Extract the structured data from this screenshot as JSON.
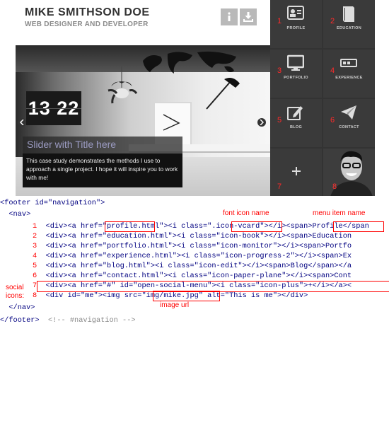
{
  "site": {
    "name": "MIKE SMITHSON DOE",
    "role": "WEB DESIGNER AND DEVELOPER"
  },
  "slider": {
    "clock": "13 22",
    "title": "Slider with Title here",
    "text": "This case study demonstrates the methods I use to approach a single project. I hope it will inspire you to work with me!"
  },
  "nav_tiles": [
    {
      "num": "1",
      "label": "PROFILE",
      "icon": "vcard-icon"
    },
    {
      "num": "2",
      "label": "EDUCATION",
      "icon": "book-icon"
    },
    {
      "num": "3",
      "label": "PORTFOLIO",
      "icon": "monitor-icon"
    },
    {
      "num": "4",
      "label": "EXPERIENCE",
      "icon": "progress-icon"
    },
    {
      "num": "5",
      "label": "BLOG",
      "icon": "edit-icon"
    },
    {
      "num": "6",
      "label": "CONTACT",
      "icon": "paper-plane-icon"
    },
    {
      "num": "7",
      "label": "",
      "icon": "plus-icon"
    },
    {
      "num": "8",
      "label": "",
      "icon": "photo"
    }
  ],
  "code": {
    "line_open_footer": "<footer id=\"navigation\">",
    "line_open_nav": "  <nav>",
    "lines": [
      {
        "num": "1",
        "text": "  <div><a href=\"profile.html\"><i class=\".icon-vcard\"></i><span>Profile</span"
      },
      {
        "num": "2",
        "text": "  <div><a href=\"education.html\"><i class=\"icon-book\"></i><span>Education"
      },
      {
        "num": "3",
        "text": "  <div><a href=\"portfolio.html\"><i class=\"icon-monitor\"></i><span>Portfo"
      },
      {
        "num": "4",
        "text": "  <div><a href=\"experience.html\"><i class=\"icon-progress-2\"></i><span>Ex"
      },
      {
        "num": "5",
        "text": "  <div><a href=\"blog.html\"><i class=\"icon-edit\"></i><span>Blog</span></a"
      },
      {
        "num": "6",
        "text": "  <div><a href=\"contact.html\"><i class=\"icon-paper-plane\"></i><span>Cont"
      },
      {
        "num": "7",
        "text": "  <div><a href=\"#\" id=\"open-social-menu\"><i class=\"icon-plus\">+</i></a><"
      },
      {
        "num": "8",
        "text": "  <div id=\"me\"><img src=\"img/mike.jpg\" alt=\"This is me\"></div>"
      }
    ],
    "line_close_nav": "  </nav>",
    "line_close_footer": "</footer>",
    "comment": "  <!-- #navigation -->"
  },
  "annotations": {
    "font_icon_name": "font icon name",
    "menu_item_name": "menu item name",
    "social_icons": "social\nicons:",
    "image_url": "image url"
  }
}
